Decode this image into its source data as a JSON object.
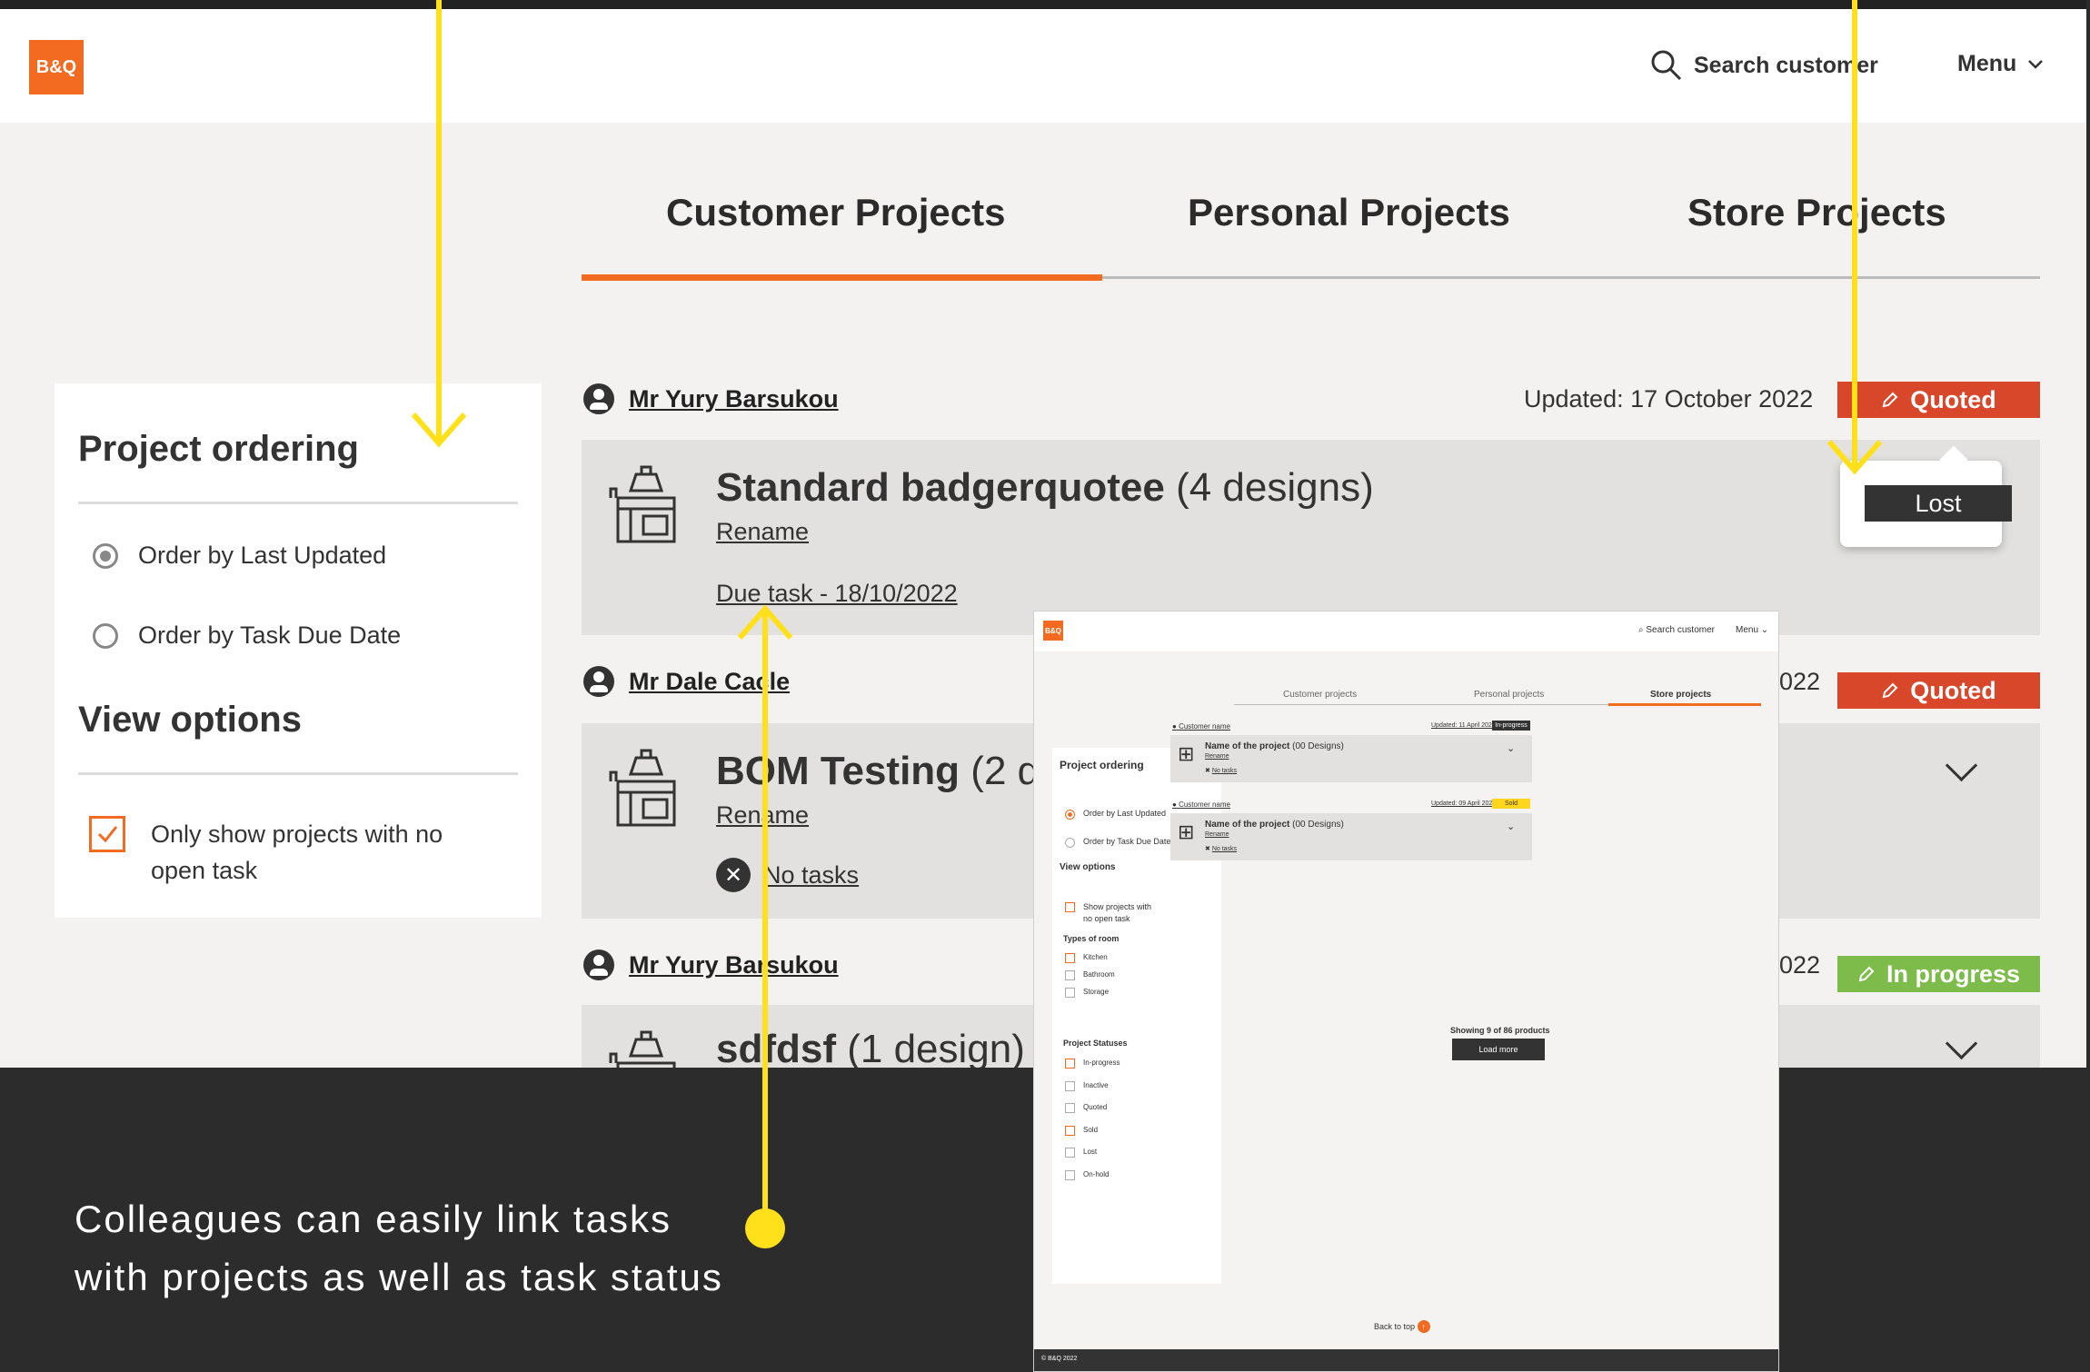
{
  "header": {
    "logo": "B&Q",
    "search_label": "Search customer",
    "menu_label": "Menu"
  },
  "tabs": [
    {
      "label": "Customer Projects",
      "active": true
    },
    {
      "label": "Personal Projects",
      "active": false
    },
    {
      "label": "Store Projects",
      "active": false
    }
  ],
  "sidebar": {
    "ordering_title": "Project ordering",
    "ordering_options": [
      {
        "label": "Order by Last Updated",
        "selected": true
      },
      {
        "label": "Order by Task Due Date",
        "selected": false
      }
    ],
    "view_title": "View options",
    "view_option": {
      "line1": "Only show projects with no",
      "line2": "open task",
      "checked": true
    }
  },
  "projects": [
    {
      "customer": "Mr Yury Barsukou",
      "updated": "Updated: 17 October 2022",
      "status": "Quoted",
      "status_color": "#d9472b",
      "title": "Standard badgerquotee",
      "designs": "(4 designs)",
      "rename": "Rename",
      "task": "Due task - 18/10/2022",
      "dropdown_option": "Lost"
    },
    {
      "customer": "Mr Dale Cacle",
      "updated_partial": "022",
      "status": "Quoted",
      "status_color": "#d9472b",
      "title": "BOM Testing",
      "designs": "(2 d",
      "rename": "Rename",
      "task": "No tasks"
    },
    {
      "customer": "Mr Yury Barsukou",
      "updated_partial": "022",
      "status": "In progress",
      "status_color": "#7dbb4a",
      "title": "sdfdsf",
      "designs": "(1 design)"
    }
  ],
  "thumbnail": {
    "logo": "B&Q",
    "search": "Search customer",
    "menu": "Menu",
    "tabs": [
      "Customer projects",
      "Personal projects",
      "Store projects"
    ],
    "ordering_title": "Project ordering",
    "order_last": "Order by Last Updated",
    "order_due": "Order by Task Due Date",
    "view_title": "View options",
    "show_line1": "Show projects with",
    "show_line2": "no open task",
    "room_title": "Types of room",
    "rooms": [
      {
        "label": "Kitchen",
        "checked": true
      },
      {
        "label": "Bathroom",
        "checked": false
      },
      {
        "label": "Storage",
        "checked": false
      }
    ],
    "status_title": "Project Statuses",
    "statuses": [
      {
        "label": "In-progress",
        "checked": true
      },
      {
        "label": "Inactive",
        "checked": false
      },
      {
        "label": "Quoted",
        "checked": false
      },
      {
        "label": "Sold",
        "checked": true
      },
      {
        "label": "Lost",
        "checked": false
      },
      {
        "label": "On-hold",
        "checked": false
      }
    ],
    "cards": [
      {
        "customer": "Customer name",
        "updated": "Updated: 11 April 2022",
        "badge": "In-progress",
        "badge_color": "#333333",
        "title": "Name of the project",
        "designs": "(00 Designs)",
        "rename": "Rename",
        "task": "No tasks"
      },
      {
        "customer": "Customer name",
        "updated": "Updated: 09 April 2022",
        "badge": "Sold",
        "badge_color": "#ffd51e",
        "title": "Name of the project",
        "designs": "(00 Designs)",
        "rename": "Rename",
        "task": "No tasks"
      }
    ],
    "showing": "Showing 9 of 86 products",
    "load_more": "Load more",
    "back_to_top": "Back to top",
    "footer": "© B&Q 2022"
  },
  "caption": {
    "line1": "Colleagues can easily link tasks",
    "line2": "with projects as well as task status"
  },
  "colors": {
    "accent": "#f26b21",
    "annotation": "#ffe01b",
    "quoted": "#d9472b",
    "in_progress": "#7dbb4a"
  }
}
